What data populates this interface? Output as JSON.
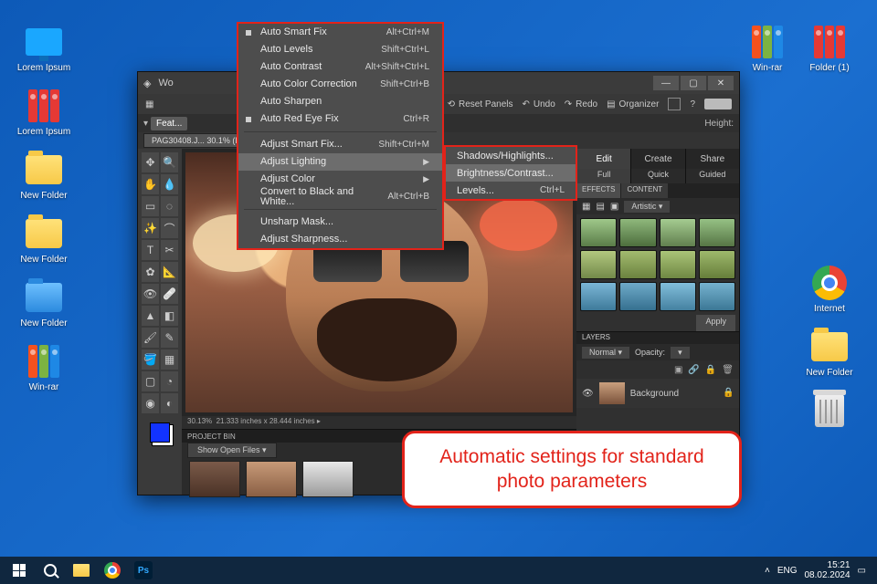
{
  "desktop": {
    "icons_left": [
      {
        "label": "Lorem Ipsum",
        "kind": "monitor"
      },
      {
        "label": "Lorem Ipsum",
        "kind": "binders-red"
      },
      {
        "label": "New Folder",
        "kind": "folder"
      },
      {
        "label": "New Folder",
        "kind": "folder"
      },
      {
        "label": "New Folder",
        "kind": "folder-blue"
      },
      {
        "label": "Win-rar",
        "kind": "binders-mix"
      }
    ],
    "icons_right": [
      {
        "label": "Win-rar",
        "kind": "binders-mix"
      },
      {
        "label": "Folder (1)",
        "kind": "binders-red"
      },
      {
        "label": "Internet",
        "kind": "chrome"
      },
      {
        "label": "New Folder",
        "kind": "folder"
      },
      {
        "label": "",
        "kind": "trash"
      }
    ]
  },
  "app": {
    "titlebar": {
      "icon_label": "Wo"
    },
    "toolbar": {
      "reset_panels": "Reset Panels",
      "undo": "Undo",
      "redo": "Redo",
      "organizer": "Organizer"
    },
    "cat_row": {
      "featured": "Feat...",
      "width": "",
      "height": "Height:"
    },
    "tab": "PAG30408.J...  30.1% (RGB/8) *",
    "status_left": "30.13%",
    "status_dims": "21.333 inches x 28.444 inches",
    "projectbin": {
      "title": "PROJECT BIN",
      "dropdown": "Show Open Files"
    },
    "right": {
      "tabs": {
        "edit": "Edit",
        "create": "Create",
        "share": "Share"
      },
      "mini": {
        "full": "Full",
        "quick": "Quick",
        "guided": "Guided"
      },
      "panel_tabs": {
        "effects": "EFFECTS",
        "content": "CONTENT"
      },
      "artistic": "Artistic",
      "apply": "Apply",
      "layers": "LAYERS",
      "blend": "Normal",
      "opacity_label": "Opacity:",
      "layer_bg": "Background"
    }
  },
  "menu": {
    "items": [
      {
        "label": "Auto Smart Fix",
        "shortcut": "Alt+Ctrl+M",
        "bullet": true
      },
      {
        "label": "Auto Levels",
        "shortcut": "Shift+Ctrl+L"
      },
      {
        "label": "Auto Contrast",
        "shortcut": "Alt+Shift+Ctrl+L"
      },
      {
        "label": "Auto Color Correction",
        "shortcut": "Shift+Ctrl+B"
      },
      {
        "label": "Auto Sharpen"
      },
      {
        "label": "Auto Red Eye Fix",
        "shortcut": "Ctrl+R",
        "bullet": true
      }
    ],
    "group2": [
      {
        "label": "Adjust Smart Fix...",
        "shortcut": "Shift+Ctrl+M"
      },
      {
        "label": "Adjust Lighting",
        "submenu": true,
        "highlight": true
      },
      {
        "label": "Adjust Color",
        "submenu": true
      },
      {
        "label": "Convert to Black and White...",
        "shortcut": "Alt+Ctrl+B"
      }
    ],
    "group3": [
      {
        "label": "Unsharp Mask..."
      },
      {
        "label": "Adjust Sharpness..."
      }
    ]
  },
  "submenu": {
    "items": [
      {
        "label": "Shadows/Highlights..."
      },
      {
        "label": "Brightness/Contrast...",
        "highlight": true
      },
      {
        "label": "Levels...",
        "shortcut": "Ctrl+L"
      }
    ]
  },
  "callout": {
    "line1": "Automatic settings for standard",
    "line2": "photo parameters"
  },
  "taskbar": {
    "lang": "ENG",
    "time": "15:21",
    "date": "08.02.2024"
  }
}
